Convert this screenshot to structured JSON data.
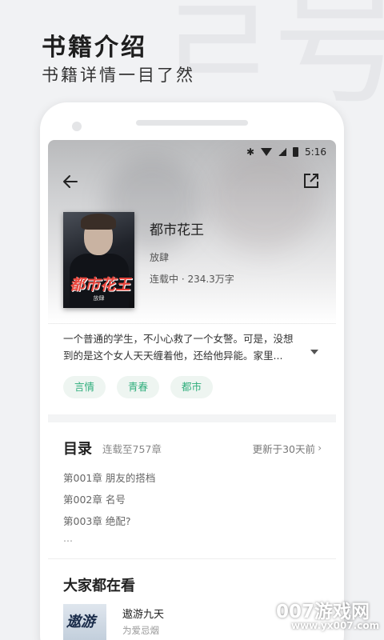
{
  "promo": {
    "title": "书籍介绍",
    "subtitle": "书籍详情一目了然"
  },
  "status_bar": {
    "time": "5:16",
    "icons": [
      "bluetooth-icon",
      "wifi-icon",
      "signal-icon",
      "battery-icon"
    ]
  },
  "book": {
    "title": "都市花王",
    "author": "放肆",
    "status": "连载中 · 234.3万字",
    "cover_title": "都市花王",
    "cover_author": "放肆",
    "description_line1": "一个普通的学生，不小心救了一个女警。可是，没想",
    "description_line2": "到的是这个女人天天缠着他，还给他异能。家里...",
    "tags": [
      "言情",
      "青春",
      "都市"
    ]
  },
  "toc": {
    "title": "目录",
    "count": "连载至757章",
    "update": "更新于30天前",
    "chapters": [
      "第001章 朋友的搭档",
      "第002章 名号",
      "第003章 绝配?"
    ],
    "more": "..."
  },
  "recommend": {
    "title": "大家都在看",
    "items": [
      {
        "name": "遨游九天",
        "author": "为爱忌烟",
        "cover_text": "遨游"
      }
    ]
  },
  "watermark": {
    "text": "007游戏网",
    "url": "www.yx007.com"
  },
  "colors": {
    "accent": "#2fae7c",
    "tag_bg": "#eef5f1",
    "page_bg": "#f1f2f4"
  }
}
